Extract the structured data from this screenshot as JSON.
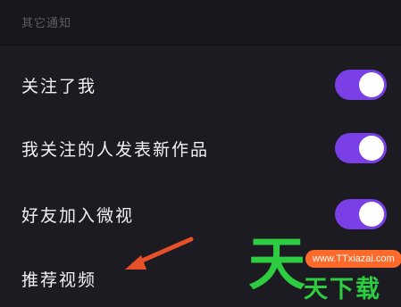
{
  "section": {
    "title": "其它通知"
  },
  "settings": [
    {
      "label": "关注了我",
      "enabled": true
    },
    {
      "label": "我关注的人发表新作品",
      "enabled": true
    },
    {
      "label": "好友加入微视",
      "enabled": true
    },
    {
      "label": "推荐视频"
    }
  ],
  "watermark": {
    "big_char": "天",
    "url": "www.TTxiazai.com",
    "brand": "天下载"
  },
  "colors": {
    "background": "#1b1b21",
    "toggle_on": "#7a3fe6",
    "arrow": "#e8502a",
    "watermark_green": "#2ecc40",
    "watermark_orange": "#ff6a2b"
  }
}
